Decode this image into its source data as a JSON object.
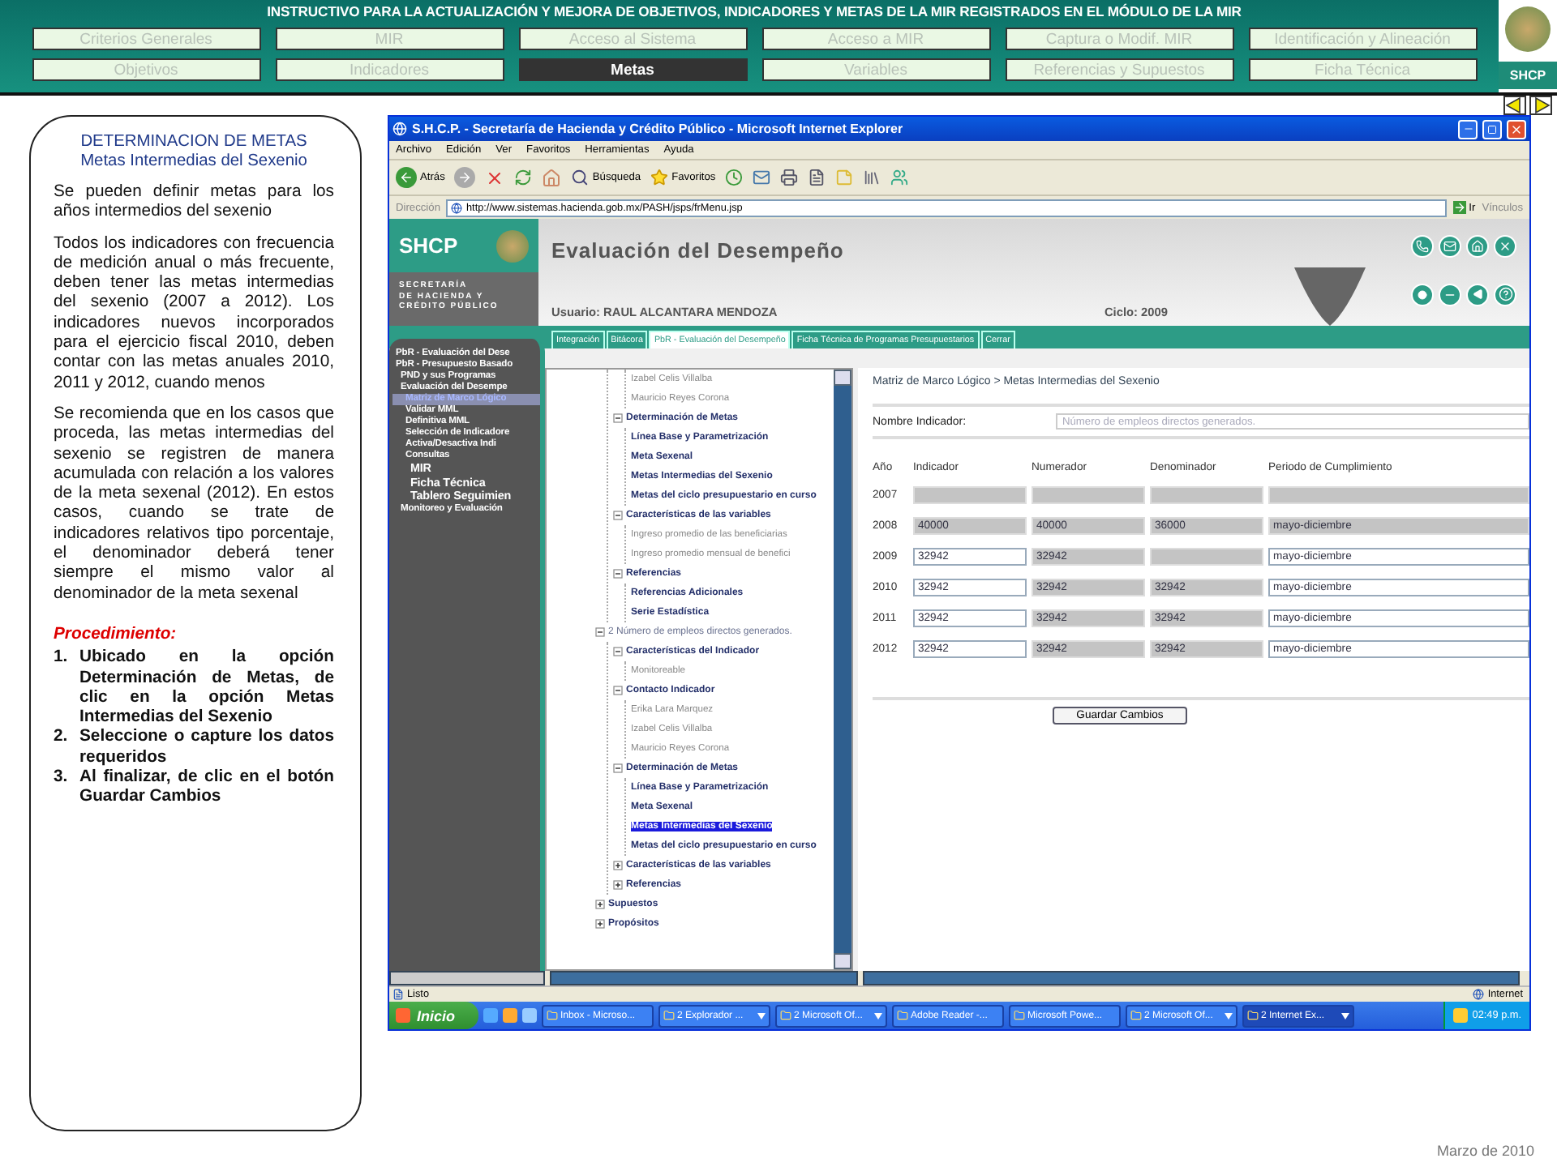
{
  "header": {
    "title": "INSTRUCTIVO PARA  LA ACTUALIZACIÓN Y MEJORA DE OBJETIVOS, INDICADORES Y METAS DE LA MIR REGISTRADOS EN EL MÓDULO DE LA MIR",
    "logo": "SHCP",
    "nav_rows": [
      [
        {
          "label": "Criterios Generales",
          "selected": false
        },
        {
          "label": "MIR",
          "selected": false
        },
        {
          "label": "Acceso al Sistema",
          "selected": false
        },
        {
          "label": "Acceso a MIR",
          "selected": false
        },
        {
          "label": "Captura o Modif. MIR",
          "selected": false
        },
        {
          "label": "Identificación y Alineación",
          "selected": false
        }
      ],
      [
        {
          "label": "Objetivos",
          "selected": false
        },
        {
          "label": "Indicadores",
          "selected": false
        },
        {
          "label": "Metas",
          "selected": true
        },
        {
          "label": "Variables",
          "selected": false
        },
        {
          "label": "Referencias y Supuestos",
          "selected": false
        },
        {
          "label": "Ficha Técnica",
          "selected": false
        }
      ]
    ]
  },
  "instructions": {
    "heading": "DETERMINACION DE METAS",
    "subheading": "Metas Intermedias del Sexenio",
    "paragraphs": [
      "Se pueden definir metas para los años intermedios del sexenio",
      "Todos los indicadores con frecuencia de medición anual o más frecuente, deben tener las metas intermedias del sexenio (2007 a 2012). Los indicadores nuevos incorporados para el ejercicio fiscal 2010, deben contar con las metas anuales 2010, 2011 y 2012, cuando menos",
      "Se recomienda que en los casos que proceda, las metas intermedias del sexenio se registren de manera acumulada con relación a los valores de la meta sexenal (2012). En estos casos, cuando se trate de indicadores relativos tipo porcentaje, el denominador deberá tener siempre el mismo valor al denominador de la meta sexenal"
    ],
    "procedure_label": "Procedimiento:",
    "steps": [
      {
        "number": "1.",
        "text": "Ubicado en la opción Determinación de Metas, de clic en la opción Metas Intermedias del Sexenio"
      },
      {
        "number": "2.",
        "text": "Seleccione o capture los datos requeridos"
      },
      {
        "number": "3.",
        "text": "Al finalizar, de clic en el botón Guardar Cambios"
      }
    ]
  },
  "browser": {
    "title": "S.H.C.P. - Secretaría de Hacienda y Crédito Público - Microsoft Internet Explorer",
    "menu": [
      "Archivo",
      "Edición",
      "Ver",
      "Favoritos",
      "Herramientas",
      "Ayuda"
    ],
    "back_label": "Atrás",
    "search_label": "Búsqueda",
    "favorites_label": "Favoritos",
    "address_label": "Dirección",
    "url": "http://www.sistemas.hacienda.gob.mx/PASH/jsps/frMenu.jsp",
    "go_label": "Ir",
    "links_label": "Vínculos",
    "app": {
      "logo": "SHCP",
      "org_lines": [
        "SECRETARÍA",
        "DE HACIENDA Y",
        "CRÉDITO PÚBLICO"
      ],
      "title": "Evaluación del Desempeño",
      "user": "Usuario: RAUL ALCANTARA MENDOZA",
      "cycle": "Ciclo: 2009",
      "tabs": [
        {
          "label": "Integración",
          "selected": false
        },
        {
          "label": "Bitácora",
          "selected": false
        },
        {
          "label": "PbR - Evaluación del Desempeño",
          "selected": true
        },
        {
          "label": "Ficha Técnica de Programas Presupuestarios",
          "selected": false
        },
        {
          "label": "Cerrar",
          "selected": false
        }
      ],
      "side_menu": [
        {
          "label": "PbR - Evaluación del Dese",
          "selected": false
        },
        {
          "label": "PbR - Presupuesto Basado",
          "selected": false,
          "children": [
            {
              "label": "PND y sus Programas",
              "selected": false
            },
            {
              "label": "Evaluación del Desempe",
              "selected": false,
              "children": [
                {
                  "label": "Matriz de Marco Lógico",
                  "selected": true
                },
                {
                  "label": "Validar MML",
                  "selected": false
                },
                {
                  "label": "Definitiva MML",
                  "selected": false
                },
                {
                  "label": "Selección de Indicadore",
                  "selected": false
                },
                {
                  "label": "Activa/Desactiva Indi",
                  "selected": false
                },
                {
                  "label": "Consultas",
                  "selected": false,
                  "children": [
                    {
                      "label": "MIR",
                      "selected": false
                    },
                    {
                      "label": "Ficha Técnica",
                      "selected": false
                    },
                    {
                      "label": "Tablero Seguimien",
                      "selected": false
                    }
                  ]
                }
              ]
            },
            {
              "label": "Monitoreo y Evaluación",
              "selected": false
            }
          ]
        }
      ],
      "tree": [
        {
          "children": [
            {
              "children": [
                {
                  "label": "Izabel Celis Villalba",
                  "kind": "info",
                  "selected": false
                },
                {
                  "label": "Mauricio Reyes Corona",
                  "kind": "info",
                  "selected": false
                }
              ]
            },
            {
              "label": "Determinación de Metas",
              "kind": "folder",
              "expanded": true,
              "selected": false,
              "children": [
                {
                  "label": "Línea Base y Parametrización",
                  "kind": "action",
                  "selected": false
                },
                {
                  "label": "Meta Sexenal",
                  "kind": "action",
                  "selected": false
                },
                {
                  "label": "Metas Intermedias del Sexenio",
                  "kind": "action",
                  "selected": false
                },
                {
                  "label": "Metas del ciclo presupuestario en curso",
                  "kind": "action",
                  "selected": false
                }
              ]
            },
            {
              "label": "Características de las variables",
              "kind": "folder",
              "expanded": true,
              "selected": false,
              "children": [
                {
                  "label": "Ingreso promedio de las beneficiarias",
                  "kind": "info",
                  "selected": false
                },
                {
                  "label": "Ingreso promedio mensual de benefici",
                  "kind": "info",
                  "selected": false
                }
              ]
            },
            {
              "label": "Referencias",
              "kind": "folder",
              "expanded": true,
              "selected": false,
              "children": [
                {
                  "label": "Referencias Adicionales",
                  "kind": "action",
                  "selected": false
                },
                {
                  "label": "Serie Estadística",
                  "kind": "action",
                  "selected": false
                }
              ]
            }
          ]
        },
        {
          "label": "2 Número de empleos directos generados.",
          "kind": "root",
          "expanded": true,
          "selected": false,
          "children": [
            {
              "label": "Características del Indicador",
              "kind": "folder",
              "expanded": true,
              "selected": false,
              "children": [
                {
                  "label": "Monitoreable",
                  "kind": "info",
                  "selected": false
                }
              ]
            },
            {
              "label": "Contacto Indicador",
              "kind": "folder",
              "expanded": true,
              "selected": false,
              "children": [
                {
                  "label": "Erika Lara Marquez",
                  "kind": "info",
                  "selected": false
                },
                {
                  "label": "Izabel Celis Villalba",
                  "kind": "info",
                  "selected": false
                },
                {
                  "label": "Mauricio Reyes Corona",
                  "kind": "info",
                  "selected": false
                }
              ]
            },
            {
              "label": "Determinación de Metas",
              "kind": "folder",
              "expanded": true,
              "selected": false,
              "children": [
                {
                  "label": "Línea Base y Parametrización",
                  "kind": "action",
                  "selected": false
                },
                {
                  "label": "Meta Sexenal",
                  "kind": "action",
                  "selected": false
                },
                {
                  "label": "Metas Intermedias del Sexenio",
                  "kind": "action",
                  "selected": true
                },
                {
                  "label": "Metas del ciclo presupuestario en curso",
                  "kind": "action",
                  "selected": false
                }
              ]
            },
            {
              "label": "Características de las variables",
              "kind": "folder",
              "expanded": false,
              "selected": false
            },
            {
              "label": "Referencias",
              "kind": "folder",
              "expanded": false,
              "selected": false
            }
          ]
        },
        {
          "label": "Supuestos",
          "kind": "folder",
          "expanded": false,
          "selected": false
        },
        {
          "label": "Propósitos",
          "kind": "folder",
          "expanded": false,
          "selected": false
        }
      ],
      "form": {
        "breadcrumb": "Matriz de Marco Lógico > Metas Intermedias del Sexenio",
        "indicator_label": "Nombre Indicador:",
        "indicator_value": "Número de empleos directos generados.",
        "columns": [
          "Año",
          "Indicador",
          "Numerador",
          "Denominador",
          "Periodo de Cumplimiento"
        ],
        "rows": [
          {
            "cells": [
              {
                "kind": "year",
                "value": "2007"
              },
              {
                "kind": "input",
                "disabled": true
              },
              {
                "kind": "input",
                "disabled": true
              },
              {
                "kind": "input",
                "disabled": true
              },
              {
                "kind": "input",
                "disabled": true
              }
            ]
          },
          {
            "cells": [
              {
                "kind": "year",
                "value": "2008"
              },
              {
                "kind": "input",
                "value": "40000",
                "disabled": true
              },
              {
                "kind": "input",
                "value": "40000",
                "disabled": true
              },
              {
                "kind": "input",
                "value": "36000",
                "disabled": true
              },
              {
                "kind": "input",
                "value": "mayo-diciembre",
                "disabled": true
              }
            ]
          },
          {
            "cells": [
              {
                "kind": "year",
                "value": "2009"
              },
              {
                "kind": "input",
                "value": "32942",
                "disabled": false
              },
              {
                "kind": "input",
                "value": "32942",
                "disabled": true
              },
              {
                "kind": "input",
                "disabled": true
              },
              {
                "kind": "input",
                "value": "mayo-diciembre",
                "disabled": false
              }
            ]
          },
          {
            "cells": [
              {
                "kind": "year",
                "value": "2010"
              },
              {
                "kind": "input",
                "value": "32942",
                "disabled": false
              },
              {
                "kind": "input",
                "value": "32942",
                "disabled": true
              },
              {
                "kind": "input",
                "value": "32942",
                "disabled": true
              },
              {
                "kind": "input",
                "value": "mayo-diciembre",
                "disabled": false
              }
            ]
          },
          {
            "cells": [
              {
                "kind": "year",
                "value": "2011"
              },
              {
                "kind": "input",
                "value": "32942",
                "disabled": false
              },
              {
                "kind": "input",
                "value": "32942",
                "disabled": true
              },
              {
                "kind": "input",
                "value": "32942",
                "disabled": true
              },
              {
                "kind": "input",
                "value": "mayo-diciembre",
                "disabled": false
              }
            ]
          },
          {
            "cells": [
              {
                "kind": "year",
                "value": "2012"
              },
              {
                "kind": "input",
                "value": "32942",
                "disabled": false
              },
              {
                "kind": "input",
                "value": "32942",
                "disabled": true
              },
              {
                "kind": "input",
                "value": "32942",
                "disabled": true
              },
              {
                "kind": "input",
                "value": "mayo-diciembre",
                "disabled": false
              }
            ]
          }
        ],
        "save_button": "Guardar Cambios"
      }
    },
    "status": "Listo",
    "zone": "Internet"
  },
  "taskbar": {
    "start": "Inicio",
    "tasks": [
      {
        "label": "Inbox - Microso...",
        "grouped": false,
        "selected": false
      },
      {
        "label": "2 Explorador ...",
        "grouped": true,
        "selected": false
      },
      {
        "label": "2 Microsoft Of...",
        "grouped": true,
        "selected": false
      },
      {
        "label": "Adobe Reader -...",
        "grouped": false,
        "selected": false
      },
      {
        "label": "Microsoft Powe...",
        "grouped": false,
        "selected": false
      },
      {
        "label": "2 Microsoft Of...",
        "grouped": true,
        "selected": false
      },
      {
        "label": "2 Internet Ex...",
        "grouped": true,
        "selected": true
      }
    ],
    "clock": "02:49 p.m."
  },
  "footer": "Marzo de 2010"
}
